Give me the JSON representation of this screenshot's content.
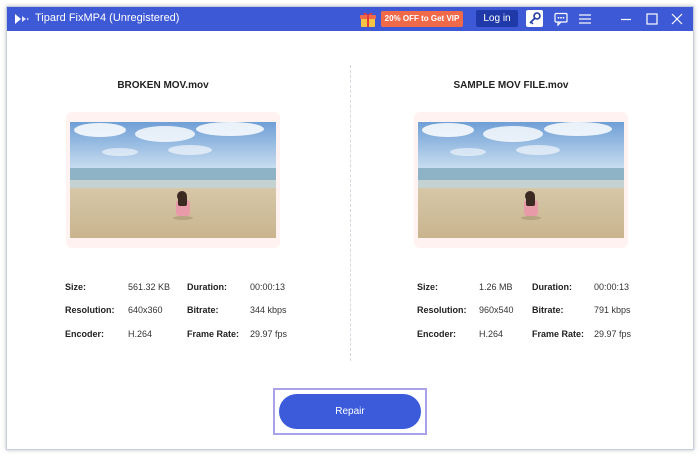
{
  "app": {
    "title": "Tipard FixMP4 (Unregistered)",
    "promo_label": "20% OFF to Get VIP",
    "login_label": "Log in"
  },
  "colors": {
    "titlebar": "#3d59d6",
    "promo": "#f06a4a",
    "login": "#1f3aa8",
    "repair": "#3b5bdb"
  },
  "icons": {
    "logo": "tipard-logo-icon",
    "gift": "gift-icon",
    "key": "key-icon",
    "feedback": "chat-feedback-icon",
    "menu": "hamburger-menu-icon",
    "minimize": "minimize-icon",
    "maximize": "maximize-icon",
    "close": "close-icon"
  },
  "labels": {
    "size": "Size:",
    "duration": "Duration:",
    "resolution": "Resolution:",
    "bitrate": "Bitrate:",
    "encoder": "Encoder:",
    "frame_rate": "Frame Rate:"
  },
  "broken": {
    "file_name": "BROKEN MOV.mov",
    "size": "561.32 KB",
    "duration": "00:00:13",
    "resolution": "640x360",
    "bitrate": "344 kbps",
    "encoder": "H.264",
    "frame_rate": "29.97 fps"
  },
  "sample": {
    "file_name": "SAMPLE MOV FILE.mov",
    "size": "1.26 MB",
    "duration": "00:00:13",
    "resolution": "960x540",
    "bitrate": "791 kbps",
    "encoder": "H.264",
    "frame_rate": "29.97 fps"
  },
  "repair_label": "Repair"
}
